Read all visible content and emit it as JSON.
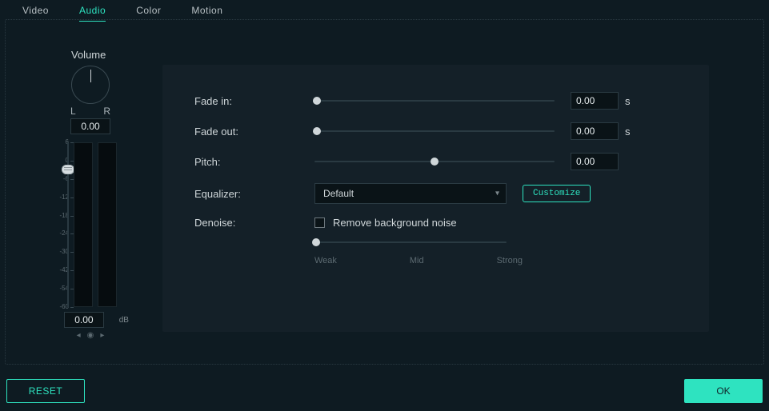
{
  "tabs": {
    "video": "Video",
    "audio": "Audio",
    "color": "Color",
    "motion": "Motion"
  },
  "volume": {
    "title": "Volume",
    "left": "L",
    "right": "R",
    "pan_value": "0.00",
    "db_value": "0.00",
    "db_unit": "dB",
    "ticks": [
      "6",
      "0",
      "-6",
      "-12",
      "-18",
      "-24",
      "-30",
      "-42",
      "-54",
      "-60"
    ],
    "mini": {
      "prev": "◂",
      "dot": "◉",
      "next": "▸"
    }
  },
  "panel": {
    "fade_in": {
      "label": "Fade in:",
      "value": "0.00",
      "unit": "s",
      "thumb_pct": 1
    },
    "fade_out": {
      "label": "Fade out:",
      "value": "0.00",
      "unit": "s",
      "thumb_pct": 1
    },
    "pitch": {
      "label": "Pitch:",
      "value": "0.00",
      "thumb_pct": 50
    },
    "equalizer": {
      "label": "Equalizer:",
      "selected": "Default",
      "customize": "Customize"
    },
    "denoise": {
      "label": "Denoise:",
      "checkbox_label": "Remove background noise",
      "thumb_pct": 1,
      "scale": {
        "weak": "Weak",
        "mid": "Mid",
        "strong": "Strong"
      }
    }
  },
  "footer": {
    "reset": "RESET",
    "ok": "OK"
  }
}
